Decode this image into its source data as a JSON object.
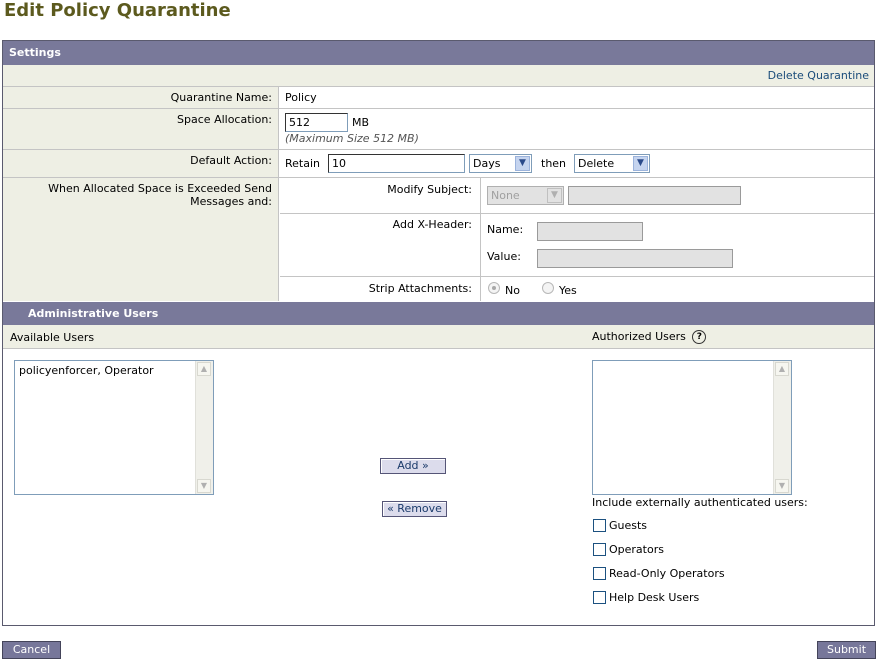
{
  "page": {
    "title": "Edit Policy Quarantine"
  },
  "settings": {
    "header": "Settings",
    "delete_link": "Delete Quarantine",
    "name": {
      "label": "Quarantine Name:",
      "value": "Policy"
    },
    "space": {
      "label": "Space Allocation:",
      "value": "512",
      "unit": "MB",
      "note": "(Maximum Size 512 MB)"
    },
    "default_action": {
      "label": "Default Action:",
      "retain_label": "Retain",
      "retain_value": "10",
      "period": "Days",
      "then_label": "then",
      "action": "Delete"
    },
    "exceeded": {
      "label": "When Allocated Space is Exceeded Send Messages and:",
      "modify_subject": {
        "label": "Modify Subject:",
        "select": "None",
        "value": ""
      },
      "x_header": {
        "label": "Add X-Header:",
        "name_label": "Name:",
        "value_label": "Value:",
        "name": "",
        "value": ""
      },
      "strip": {
        "label": "Strip Attachments:",
        "no": "No",
        "yes": "Yes",
        "selected": "No"
      }
    }
  },
  "admin": {
    "header": "Administrative Users",
    "available_label": "Available Users",
    "authorized_label": "Authorized Users",
    "help_glyph": "?",
    "available_users": [
      "policyenforcer, Operator"
    ],
    "authorized_users": [],
    "add_button": "Add »",
    "remove_button": "« Remove",
    "external_label": "Include externally authenticated users:",
    "external_options": [
      {
        "label": "Guests",
        "checked": false
      },
      {
        "label": "Operators",
        "checked": false
      },
      {
        "label": "Read-Only Operators",
        "checked": false
      },
      {
        "label": "Help Desk Users",
        "checked": false
      }
    ]
  },
  "footer": {
    "cancel": "Cancel",
    "submit": "Submit"
  },
  "colors": {
    "title": "#5c5a1e",
    "header_bg": "#79799a",
    "label_bg": "#eeefe4",
    "link": "#1a4c7a"
  },
  "icons": {
    "dropdown": "chevron-down-icon",
    "help": "help-circle-icon"
  }
}
